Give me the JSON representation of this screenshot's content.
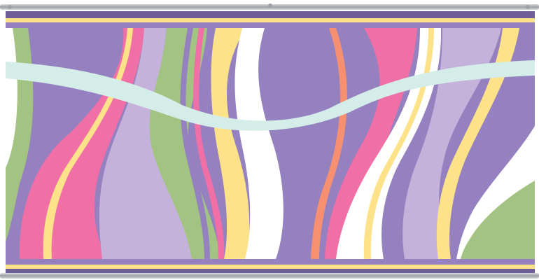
{
  "palette": {
    "background": "#ffffff",
    "purple": "#9581bf",
    "lavender": "#c4b2da",
    "pink": "#ef6fa6",
    "green": "#a2c381",
    "yellow": "#fde28a",
    "white": "#ffffff",
    "mint": "#d5ede8",
    "orange": "#f69070",
    "rail_light": "#d6d8db",
    "rail_dark": "#9ea1a6",
    "band_dark": "#6e5d97"
  },
  "icons": {
    "hanger_clip": "hanger-clip-icon"
  }
}
